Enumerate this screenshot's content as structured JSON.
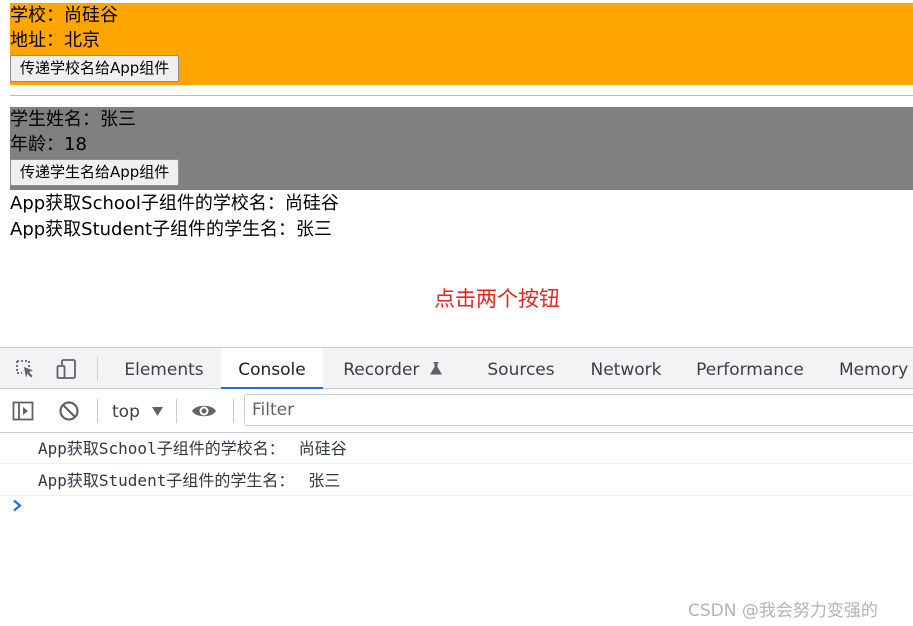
{
  "school": {
    "name_line": "学校：尚硅谷",
    "address_line": "地址：北京",
    "button_label": "传递学校名给App组件"
  },
  "student": {
    "name_line": "学生姓名：张三",
    "age_line": "年龄：18",
    "button_label": "传递学生名给App组件"
  },
  "app": {
    "school_result": "App获取School子组件的学校名：尚硅谷",
    "student_result": "App获取Student子组件的学生名：张三"
  },
  "annotation": "点击两个按钮",
  "devtools": {
    "tabs": [
      {
        "label": "Elements"
      },
      {
        "label": "Console"
      },
      {
        "label": "Recorder"
      },
      {
        "label": "Sources"
      },
      {
        "label": "Network"
      },
      {
        "label": "Performance"
      },
      {
        "label": "Memory"
      }
    ],
    "active_tab": "Console",
    "context": "top",
    "filter_placeholder": "Filter",
    "logs": [
      {
        "text": "App获取School子组件的学校名：",
        "value": "尚硅谷"
      },
      {
        "text": "App获取Student子组件的学生名：",
        "value": "张三"
      }
    ],
    "accent_color": "#1a73e8"
  },
  "watermark": "CSDN @我会努力变强的"
}
